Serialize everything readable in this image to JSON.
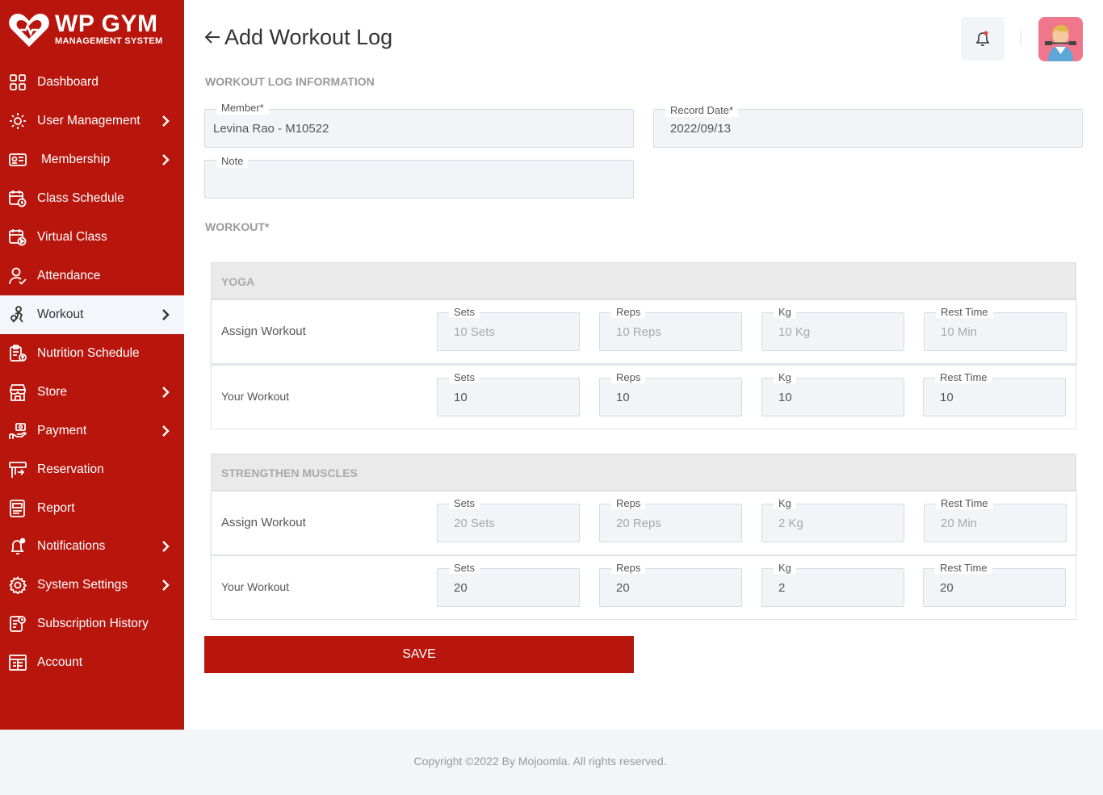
{
  "brand": {
    "title": "WP GYM",
    "subtitle": "MANAGEMENT SYSTEM"
  },
  "colors": {
    "accent": "#b8150d",
    "sidebar_active_bg": "#f4f6fb",
    "field_bg": "#f2f4f8",
    "avatar_bg": "#f0768b"
  },
  "sidebar": {
    "items": [
      {
        "label": "Dashboard",
        "icon": "dashboard-icon",
        "chevron": false
      },
      {
        "label": "User Management",
        "icon": "users-gear-icon",
        "chevron": true
      },
      {
        "label": "Membership",
        "icon": "membership-card-icon",
        "chevron": true
      },
      {
        "label": "Class Schedule",
        "icon": "calendar-clock-icon",
        "chevron": false
      },
      {
        "label": "Virtual Class",
        "icon": "calendar-video-icon",
        "chevron": false
      },
      {
        "label": "Attendance",
        "icon": "user-check-icon",
        "chevron": false
      },
      {
        "label": "Workout",
        "icon": "workout-icon",
        "chevron": true,
        "active": true
      },
      {
        "label": "Nutrition Schedule",
        "icon": "nutrition-clipboard-icon",
        "chevron": false
      },
      {
        "label": "Store",
        "icon": "store-icon",
        "chevron": true
      },
      {
        "label": "Payment",
        "icon": "payment-hand-icon",
        "chevron": true
      },
      {
        "label": "Reservation",
        "icon": "reservation-icon",
        "chevron": false
      },
      {
        "label": "Report",
        "icon": "report-icon",
        "chevron": false
      },
      {
        "label": "Notifications",
        "icon": "bell-icon",
        "chevron": true
      },
      {
        "label": "System Settings",
        "icon": "gear-icon",
        "chevron": true
      },
      {
        "label": "Subscription History",
        "icon": "subscription-history-icon",
        "chevron": false
      },
      {
        "label": "Account",
        "icon": "account-icon",
        "chevron": false
      }
    ]
  },
  "header": {
    "title": "Add Workout Log",
    "back_icon": "arrow-left-icon",
    "bell_icon": "bell-icon",
    "avatar_icon": "user-avatar-icon"
  },
  "form": {
    "section_title": "WORKOUT LOG INFORMATION",
    "member": {
      "label": "Member*",
      "value": "Levina Rao - M10522"
    },
    "record_date": {
      "label": "Record Date*",
      "value": "2022/09/13"
    },
    "note": {
      "label": "Note",
      "value": ""
    },
    "workout_title": "WORKOUT*"
  },
  "workouts": [
    {
      "name": "YOGA",
      "assign": {
        "label": "Assign Workout",
        "sets": "10 Sets",
        "reps": "10 Reps",
        "kg": "10 Kg",
        "rest": "10 Min"
      },
      "yours": {
        "label": "Your Workout",
        "sets": "10",
        "reps": "10",
        "kg": "10",
        "rest": "10"
      }
    },
    {
      "name": "STRENGTHEN MUSCLES",
      "assign": {
        "label": "Assign Workout",
        "sets": "20 Sets",
        "reps": "20 Reps",
        "kg": "2 Kg",
        "rest": "20 Min"
      },
      "yours": {
        "label": "Your Workout",
        "sets": "20",
        "reps": "20",
        "kg": "2",
        "rest": "20"
      }
    }
  ],
  "field_labels": {
    "sets": "Sets",
    "reps": "Reps",
    "kg": "Kg",
    "rest": "Rest Time"
  },
  "save_label": "SAVE",
  "footer": "Copyright ©2022 By Mojoomla. All rights reserved."
}
